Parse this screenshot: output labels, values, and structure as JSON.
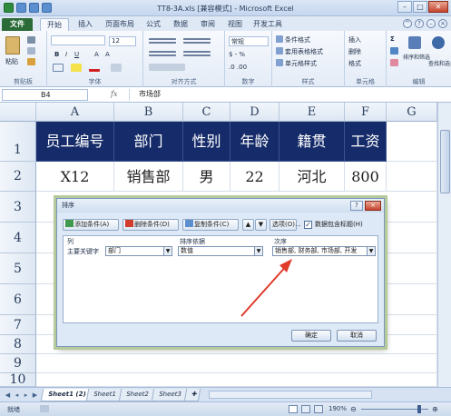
{
  "window": {
    "title": "TT8-3A.xls [兼容模式] - Microsoft Excel"
  },
  "tabs": [
    "文件",
    "开始",
    "插入",
    "页面布局",
    "公式",
    "数据",
    "审阅",
    "视图",
    "开发工具"
  ],
  "ribbon": {
    "groups": [
      "剪贴板",
      "字体",
      "对齐方式",
      "数字",
      "样式",
      "单元格",
      "编辑"
    ],
    "paste": "粘贴",
    "font_size": "12",
    "number_format": "常规",
    "currency": "$ - %",
    "style_cond": "条件格式",
    "style_table": "套用表格格式",
    "style_cell": "单元格样式",
    "cell_insert": "插入",
    "cell_delete": "删除",
    "cell_format": "格式",
    "sort_filter": "排序和筛选",
    "find_select": "查找和选择"
  },
  "formula_bar": {
    "name_box": "B4",
    "fx": "fx",
    "value": "市场部"
  },
  "columns": [
    "A",
    "B",
    "C",
    "D",
    "E",
    "F",
    "G"
  ],
  "rows": [
    "1",
    "2",
    "3",
    "4",
    "5",
    "6",
    "7",
    "8",
    "9",
    "10"
  ],
  "table": {
    "headers": [
      "员工编号",
      "部门",
      "性别",
      "年龄",
      "籍贯",
      "工资"
    ],
    "row2": [
      "X12",
      "销售部",
      "男",
      "22",
      "河北",
      "800"
    ]
  },
  "sheets": [
    "Sheet1 (2)",
    "Sheet1",
    "Sheet2",
    "Sheet3"
  ],
  "status": {
    "ready": "就绪",
    "zoom": "190%"
  },
  "dialog": {
    "title": "排序",
    "help": "?",
    "close": "×",
    "add_level": "添加条件(A)",
    "delete_level": "删除条件(D)",
    "copy_level": "复制条件(C)",
    "options": "选项(O)...",
    "has_headers": "数据包含标题(H)",
    "col_header": "列",
    "sort_on_header": "排序依据",
    "order_header": "次序",
    "row_label": "主要关键字",
    "column_value": "部门",
    "sort_on_value": "数值",
    "order_value": "销售部, 财务部, 市场部, 开发",
    "ok": "确定",
    "cancel": "取消"
  },
  "colors": {
    "header_fill": "#162c6a",
    "accent_green": "#2a6b37",
    "arrow": "#e03a2a"
  }
}
